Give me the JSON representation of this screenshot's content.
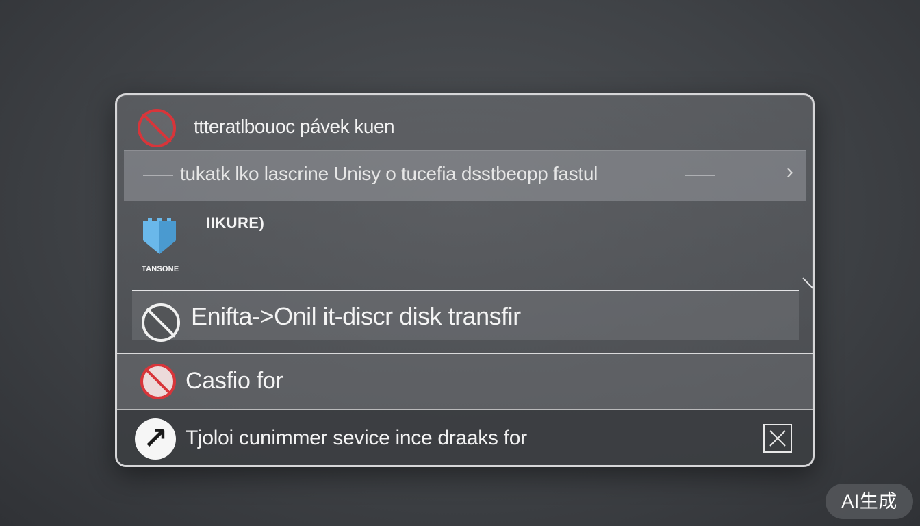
{
  "dialog": {
    "title": "ttteratlbouoc pávek kuen",
    "path_bar": {
      "text": "tukatk lko lascrine Unisy o tucefia dsstbeopp fastul"
    },
    "security": {
      "label": "IIKURE)",
      "caption": "TANSONE"
    },
    "transfer": {
      "label": "Enifta->Onil it-discr disk transfir"
    },
    "cash": {
      "label": "Casfio for"
    },
    "service": {
      "label": "Tjoloi cunimmer sevice ince draaks for"
    }
  },
  "watermark": "AI生成",
  "colors": {
    "background": "#3f4246",
    "panel_border": "#d6d6d8",
    "prohibited_red": "#d8353a",
    "shield_blue": "#6ab8ea",
    "text": "#f2f2f2"
  },
  "icons": {
    "title": "prohibited-icon",
    "path": "chevron-right-icon",
    "security": "shield-icon",
    "transfer": "prohibited-icon",
    "cash": "prohibited-icon",
    "service": "arrow-up-right-icon",
    "close": "close-box-icon"
  }
}
